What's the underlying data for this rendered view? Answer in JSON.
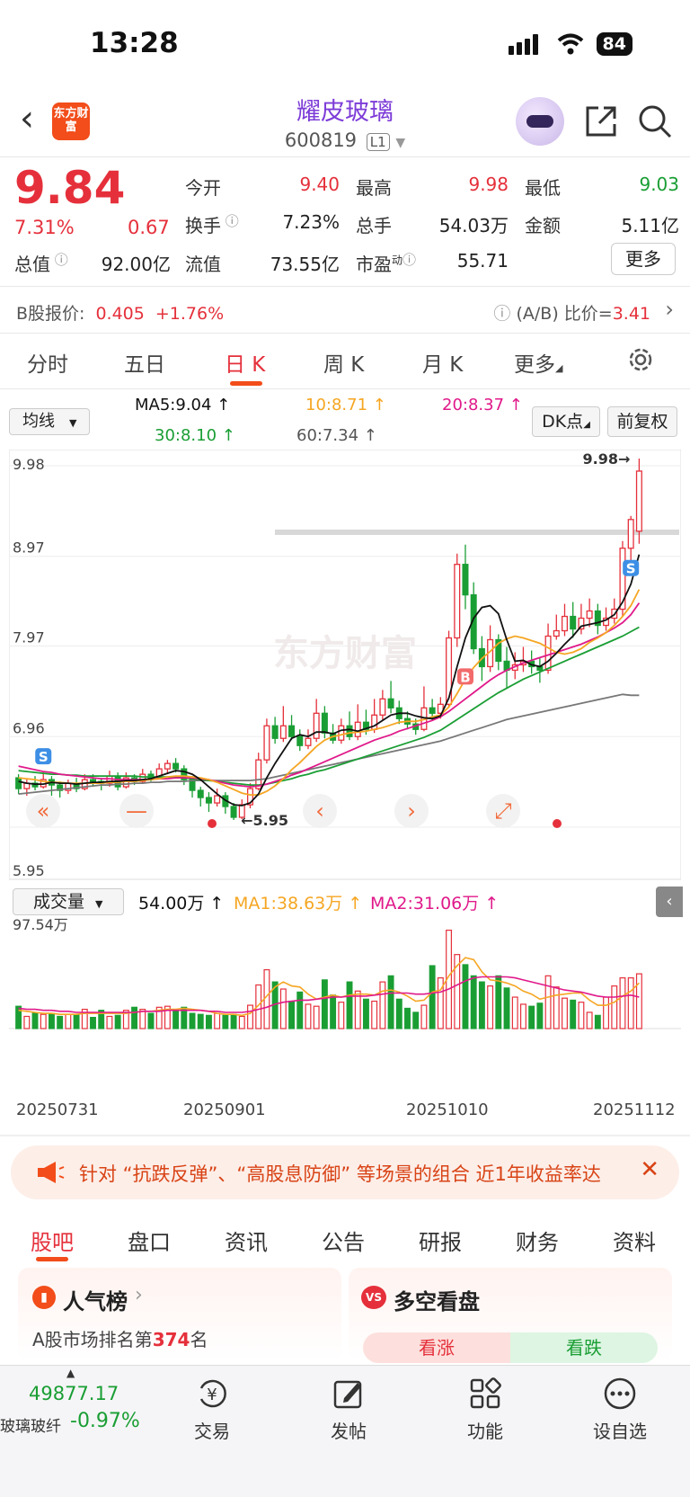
{
  "status": {
    "time": "13:28",
    "battery": "84"
  },
  "header": {
    "logo_text": "东方财富",
    "title": "耀皮玻璃",
    "code": "600819",
    "level": "L1"
  },
  "quote": {
    "price": "9.84",
    "change_pct": "7.31%",
    "change": "0.67",
    "open_label": "今开",
    "open": "9.40",
    "high_label": "最高",
    "high": "9.98",
    "low_label": "最低",
    "low": "9.03",
    "turnover_label": "换手",
    "turnover": "7.23%",
    "volume_label": "总手",
    "volume": "54.03万",
    "amount_label": "金额",
    "amount": "5.11亿",
    "mktcap_label": "总值",
    "mktcap": "92.00亿",
    "float_label": "流值",
    "float": "73.55亿",
    "pe_label": "市盈",
    "pe_sup": "动",
    "pe": "55.71",
    "more_label": "更多"
  },
  "bshare": {
    "label": "B股报价:",
    "price": "0.405",
    "pct": "+1.76%",
    "ratio_label": "(A/B) 比价=",
    "ratio": "3.41"
  },
  "period_tabs": [
    "分时",
    "五日",
    "日 K",
    "周 K",
    "月 K",
    "更多"
  ],
  "indicators": {
    "type_select": "均线",
    "ma5": "MA5:9.04 ↑",
    "ma10": "10:8.71 ↑",
    "ma20": "20:8.37 ↑",
    "ma30": "30:8.10 ↑",
    "ma60": "60:7.34 ↑",
    "dk_label": "DK点",
    "adjust_label": "前复权"
  },
  "kchart_labels": {
    "y_top": "9.98",
    "y2": "8.97",
    "y3": "7.97",
    "y4": "6.96",
    "y_bottom": "5.95",
    "max_mark": "9.98→",
    "min_mark": "←5.95",
    "buy": "B",
    "sell": "S",
    "watermark": "东方财富"
  },
  "volume": {
    "select": "成交量",
    "value": "54.00万 ↑",
    "ma1": "MA1:38.63万 ↑",
    "ma2": "MA2:31.06万 ↑",
    "y_top": "97.54万"
  },
  "dates": [
    "20250731",
    "20250901",
    "20251010",
    "20251112"
  ],
  "banner": {
    "text": "针对 “抗跌反弹”、“高股息防御” 等场景的组合 近1年收益率达"
  },
  "bottom_tabs": [
    "股吧",
    "盘口",
    "资讯",
    "公告",
    "研报",
    "财务",
    "资料"
  ],
  "cards": {
    "popularity_title": "人气榜",
    "rank_prefix": "A股市场排名第",
    "rank": "374",
    "rank_suffix": "名",
    "sentiment_title": "多空看盘",
    "bull": "看涨",
    "bear": "看跌"
  },
  "bottom_nav": {
    "index_value": "49877.17",
    "index_name": "玻璃玻纤",
    "index_pct": "-0.97%",
    "items": [
      "交易",
      "发帖",
      "功能",
      "设自选"
    ]
  },
  "colors": {
    "up": "#e5303b",
    "down": "#1a9e34",
    "accent": "#f24d1a",
    "title": "#7d3cd8",
    "ma5": "#111111",
    "ma10": "#f5a623",
    "ma20": "#e0198a",
    "ma30": "#1a9e34",
    "ma60": "#777777"
  },
  "chart_data": {
    "type": "candlestick",
    "y_range": [
      5.95,
      9.98
    ],
    "candles": [
      [
        6.42,
        6.3,
        6.46,
        6.24
      ],
      [
        6.3,
        6.36,
        6.4,
        6.22
      ],
      [
        6.36,
        6.32,
        6.44,
        6.28
      ],
      [
        6.32,
        6.4,
        6.48,
        6.3
      ],
      [
        6.4,
        6.34,
        6.44,
        6.22
      ],
      [
        6.34,
        6.28,
        6.38,
        6.2
      ],
      [
        6.28,
        6.36,
        6.4,
        6.24
      ],
      [
        6.36,
        6.3,
        6.42,
        6.26
      ],
      [
        6.3,
        6.4,
        6.46,
        6.28
      ],
      [
        6.4,
        6.38,
        6.46,
        6.32
      ],
      [
        6.38,
        6.36,
        6.42,
        6.28
      ],
      [
        6.36,
        6.44,
        6.5,
        6.32
      ],
      [
        6.44,
        6.32,
        6.48,
        6.28
      ],
      [
        6.32,
        6.42,
        6.48,
        6.3
      ],
      [
        6.42,
        6.38,
        6.46,
        6.34
      ],
      [
        6.38,
        6.46,
        6.52,
        6.36
      ],
      [
        6.46,
        6.42,
        6.5,
        6.38
      ],
      [
        6.42,
        6.52,
        6.58,
        6.4
      ],
      [
        6.52,
        6.58,
        6.62,
        6.46
      ],
      [
        6.58,
        6.52,
        6.64,
        6.48
      ],
      [
        6.52,
        6.4,
        6.56,
        6.34
      ],
      [
        6.4,
        6.28,
        6.44,
        6.2
      ],
      [
        6.28,
        6.2,
        6.32,
        6.1
      ],
      [
        6.2,
        6.14,
        6.26,
        6.04
      ],
      [
        6.14,
        6.22,
        6.3,
        6.1
      ],
      [
        6.22,
        6.1,
        6.26,
        6.02
      ],
      [
        6.1,
        5.98,
        6.14,
        5.95
      ],
      [
        5.98,
        6.12,
        6.18,
        5.96
      ],
      [
        6.12,
        6.3,
        6.36,
        6.08
      ],
      [
        6.3,
        6.62,
        6.7,
        6.28
      ],
      [
        6.62,
        7.0,
        7.08,
        6.58
      ],
      [
        7.0,
        6.86,
        7.1,
        6.8
      ],
      [
        6.86,
        7.0,
        7.22,
        6.82
      ],
      [
        7.0,
        6.88,
        7.12,
        6.84
      ],
      [
        6.88,
        6.78,
        6.96,
        6.72
      ],
      [
        6.78,
        6.86,
        6.96,
        6.74
      ],
      [
        6.86,
        7.14,
        7.3,
        6.82
      ],
      [
        7.14,
        6.92,
        7.22,
        6.86
      ],
      [
        6.92,
        6.84,
        7.02,
        6.8
      ],
      [
        6.84,
        7.0,
        7.08,
        6.8
      ],
      [
        7.0,
        6.88,
        7.16,
        6.84
      ],
      [
        6.88,
        7.04,
        7.24,
        6.84
      ],
      [
        7.04,
        6.96,
        7.18,
        6.9
      ],
      [
        6.96,
        7.12,
        7.3,
        6.92
      ],
      [
        7.12,
        7.3,
        7.4,
        7.06
      ],
      [
        7.3,
        7.2,
        7.5,
        7.14
      ],
      [
        7.2,
        7.08,
        7.28,
        7.02
      ],
      [
        7.08,
        7.02,
        7.16,
        6.96
      ],
      [
        7.02,
        6.96,
        7.08,
        6.9
      ],
      [
        6.96,
        7.2,
        7.44,
        6.94
      ],
      [
        7.2,
        7.14,
        7.3,
        7.06
      ],
      [
        7.14,
        7.24,
        7.32,
        7.08
      ],
      [
        7.24,
        7.98,
        8.06,
        7.2
      ],
      [
        7.98,
        8.8,
        8.92,
        7.88
      ],
      [
        8.8,
        8.46,
        9.02,
        8.3
      ],
      [
        8.46,
        7.86,
        8.6,
        7.8
      ],
      [
        7.86,
        7.66,
        8.0,
        7.5
      ],
      [
        7.66,
        7.96,
        8.12,
        7.6
      ],
      [
        7.96,
        7.72,
        8.02,
        7.62
      ],
      [
        7.72,
        7.62,
        7.88,
        7.42
      ],
      [
        7.62,
        7.68,
        7.82,
        7.52
      ],
      [
        7.68,
        7.72,
        7.88,
        7.6
      ],
      [
        7.72,
        7.66,
        7.84,
        7.58
      ],
      [
        7.66,
        7.62,
        7.76,
        7.48
      ],
      [
        7.62,
        8.0,
        8.14,
        7.58
      ],
      [
        8.0,
        8.06,
        8.24,
        7.96
      ],
      [
        8.06,
        8.22,
        8.36,
        8.0
      ],
      [
        8.22,
        8.08,
        8.38,
        7.98
      ],
      [
        8.08,
        8.2,
        8.36,
        8.02
      ],
      [
        8.2,
        8.28,
        8.42,
        8.1
      ],
      [
        8.28,
        8.12,
        8.36,
        8.02
      ],
      [
        8.12,
        8.2,
        8.32,
        8.06
      ],
      [
        8.2,
        8.3,
        8.42,
        8.14
      ],
      [
        8.3,
        8.98,
        9.06,
        8.22
      ],
      [
        8.98,
        9.3,
        9.34,
        8.76
      ],
      [
        9.17,
        9.84,
        9.98,
        9.03
      ]
    ],
    "ma5": [
      6.38,
      6.36,
      6.35,
      6.35,
      6.37,
      6.36,
      6.36,
      6.35,
      6.36,
      6.37,
      6.37,
      6.38,
      6.38,
      6.39,
      6.39,
      6.4,
      6.41,
      6.44,
      6.47,
      6.5,
      6.49,
      6.46,
      6.4,
      6.32,
      6.24,
      6.17,
      6.12,
      6.11,
      6.14,
      6.24,
      6.42,
      6.58,
      6.72,
      6.86,
      6.9,
      6.88,
      6.93,
      6.93,
      6.91,
      6.95,
      6.96,
      6.94,
      6.97,
      7.0,
      7.06,
      7.12,
      7.14,
      7.14,
      7.11,
      7.09,
      7.08,
      7.11,
      7.31,
      7.66,
      7.98,
      8.2,
      8.32,
      8.34,
      8.25,
      7.96,
      7.72,
      7.73,
      7.68,
      7.66,
      7.72,
      7.81,
      7.91,
      8.0,
      8.11,
      8.13,
      8.15,
      8.18,
      8.24,
      8.38,
      8.58,
      8.91
    ],
    "ma10": [
      6.42,
      6.41,
      6.4,
      6.38,
      6.37,
      6.37,
      6.36,
      6.36,
      6.36,
      6.36,
      6.36,
      6.37,
      6.37,
      6.38,
      6.38,
      6.39,
      6.4,
      6.41,
      6.43,
      6.44,
      6.44,
      6.43,
      6.42,
      6.4,
      6.37,
      6.33,
      6.29,
      6.25,
      6.23,
      6.23,
      6.27,
      6.33,
      6.41,
      6.51,
      6.59,
      6.68,
      6.77,
      6.84,
      6.88,
      6.9,
      6.92,
      6.93,
      6.94,
      6.96,
      6.98,
      7.01,
      7.04,
      7.05,
      7.05,
      7.07,
      7.1,
      7.12,
      7.21,
      7.36,
      7.52,
      7.65,
      7.75,
      7.83,
      7.92,
      7.97,
      8.0,
      7.98,
      7.95,
      7.92,
      7.87,
      7.82,
      7.8,
      7.82,
      7.86,
      7.93,
      7.98,
      8.04,
      8.12,
      8.22,
      8.34,
      8.52
    ],
    "ma20": [
      6.55,
      6.53,
      6.51,
      6.49,
      6.48,
      6.46,
      6.45,
      6.44,
      6.43,
      6.42,
      6.41,
      6.41,
      6.4,
      6.4,
      6.4,
      6.4,
      6.4,
      6.41,
      6.41,
      6.42,
      6.42,
      6.42,
      6.41,
      6.4,
      6.38,
      6.36,
      6.34,
      6.33,
      6.32,
      6.33,
      6.35,
      6.38,
      6.41,
      6.45,
      6.48,
      6.52,
      6.56,
      6.6,
      6.64,
      6.68,
      6.72,
      6.76,
      6.8,
      6.84,
      6.87,
      6.9,
      6.94,
      6.97,
      7.0,
      7.03,
      7.06,
      7.1,
      7.16,
      7.23,
      7.3,
      7.37,
      7.44,
      7.51,
      7.57,
      7.62,
      7.66,
      7.7,
      7.73,
      7.76,
      7.79,
      7.82,
      7.85,
      7.88,
      7.91,
      7.95,
      7.99,
      8.04,
      8.09,
      8.15,
      8.24,
      8.37
    ],
    "ma30": [
      6.5,
      6.49,
      6.48,
      6.47,
      6.46,
      6.46,
      6.45,
      6.45,
      6.44,
      6.44,
      6.44,
      6.44,
      6.44,
      6.44,
      6.44,
      6.43,
      6.43,
      6.43,
      6.43,
      6.43,
      6.42,
      6.41,
      6.4,
      6.39,
      6.38,
      6.37,
      6.36,
      6.35,
      6.34,
      6.34,
      6.35,
      6.37,
      6.39,
      6.41,
      6.44,
      6.46,
      6.49,
      6.51,
      6.54,
      6.57,
      6.6,
      6.63,
      6.66,
      6.69,
      6.72,
      6.75,
      6.78,
      6.81,
      6.84,
      6.87,
      6.91,
      6.95,
      7.01,
      7.07,
      7.13,
      7.19,
      7.25,
      7.31,
      7.37,
      7.42,
      7.47,
      7.52,
      7.56,
      7.6,
      7.64,
      7.68,
      7.72,
      7.76,
      7.8,
      7.84,
      7.88,
      7.92,
      7.96,
      8.0,
      8.05,
      8.1
    ],
    "ma60": [
      6.24,
      6.25,
      6.26,
      6.27,
      6.28,
      6.29,
      6.3,
      6.31,
      6.32,
      6.33,
      6.34,
      6.34,
      6.35,
      6.35,
      6.36,
      6.36,
      6.37,
      6.37,
      6.38,
      6.38,
      6.38,
      6.39,
      6.39,
      6.39,
      6.39,
      6.39,
      6.39,
      6.39,
      6.39,
      6.4,
      6.41,
      6.43,
      6.45,
      6.47,
      6.49,
      6.51,
      6.53,
      6.55,
      6.57,
      6.59,
      6.61,
      6.63,
      6.65,
      6.67,
      6.69,
      6.71,
      6.73,
      6.75,
      6.77,
      6.79,
      6.81,
      6.83,
      6.86,
      6.89,
      6.92,
      6.95,
      6.98,
      7.01,
      7.04,
      7.07,
      7.09,
      7.11,
      7.13,
      7.15,
      7.17,
      7.19,
      7.21,
      7.23,
      7.25,
      7.27,
      7.29,
      7.31,
      7.33,
      7.35,
      7.34,
      7.34
    ],
    "volume": [
      22,
      12,
      15,
      14,
      15,
      12,
      14,
      14,
      19,
      11,
      18,
      12,
      13,
      18,
      21,
      19,
      15,
      21,
      22,
      19,
      21,
      15,
      14,
      13,
      15,
      13,
      14,
      12,
      23,
      43,
      58,
      46,
      39,
      27,
      36,
      24,
      22,
      48,
      33,
      26,
      46,
      37,
      29,
      27,
      46,
      52,
      29,
      20,
      16,
      23,
      62,
      50,
      97,
      73,
      63,
      52,
      46,
      42,
      52,
      40,
      31,
      24,
      22,
      25,
      52,
      41,
      30,
      28,
      26,
      16,
      13,
      31,
      42,
      50,
      50,
      54
    ],
    "volume_ma1": [
      18,
      17,
      16,
      15,
      15,
      14,
      14,
      14,
      15,
      15,
      15,
      15,
      15,
      15,
      16,
      17,
      17,
      18,
      19,
      19,
      20,
      19,
      18,
      17,
      15,
      14,
      14,
      13,
      15,
      23,
      32,
      41,
      46,
      42,
      41,
      34,
      29,
      31,
      33,
      31,
      33,
      34,
      34,
      33,
      37,
      38,
      36,
      32,
      27,
      28,
      36,
      38,
      52,
      62,
      70,
      68,
      56,
      48,
      47,
      45,
      42,
      37,
      34,
      29,
      31,
      33,
      34,
      35,
      35,
      28,
      23,
      23,
      26,
      32,
      37,
      45
    ],
    "volume_ma2": [
      20,
      19,
      19,
      18,
      18,
      17,
      17,
      16,
      16,
      16,
      16,
      16,
      16,
      16,
      16,
      17,
      17,
      17,
      18,
      18,
      18,
      18,
      18,
      17,
      17,
      16,
      16,
      16,
      17,
      19,
      21,
      24,
      26,
      27,
      28,
      28,
      29,
      30,
      31,
      31,
      32,
      32,
      32,
      33,
      34,
      35,
      35,
      35,
      34,
      34,
      35,
      36,
      39,
      43,
      47,
      50,
      51,
      51,
      51,
      51,
      50,
      48,
      46,
      44,
      42,
      40,
      38,
      37,
      36,
      34,
      32,
      31,
      31,
      32,
      33,
      31
    ],
    "volume_ylim": [
      0,
      97.54
    ],
    "x_dates": [
      "20250731",
      "20250901",
      "20251010",
      "20251112"
    ]
  }
}
